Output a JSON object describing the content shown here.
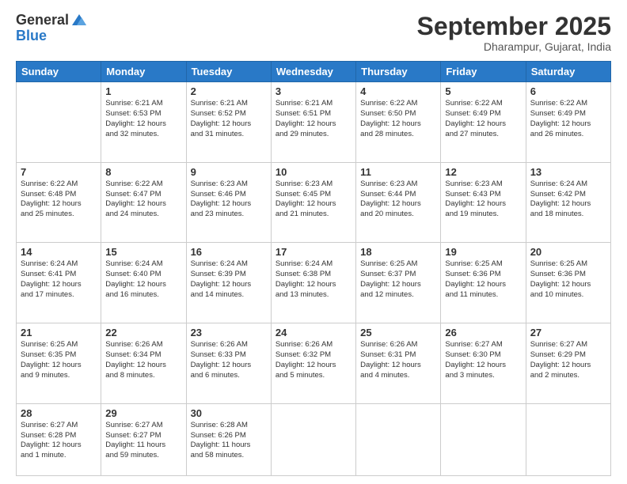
{
  "logo": {
    "general": "General",
    "blue": "Blue"
  },
  "header": {
    "month": "September 2025",
    "location": "Dharampur, Gujarat, India"
  },
  "weekdays": [
    "Sunday",
    "Monday",
    "Tuesday",
    "Wednesday",
    "Thursday",
    "Friday",
    "Saturday"
  ],
  "weeks": [
    [
      {
        "day": "",
        "info": ""
      },
      {
        "day": "1",
        "info": "Sunrise: 6:21 AM\nSunset: 6:53 PM\nDaylight: 12 hours\nand 32 minutes."
      },
      {
        "day": "2",
        "info": "Sunrise: 6:21 AM\nSunset: 6:52 PM\nDaylight: 12 hours\nand 31 minutes."
      },
      {
        "day": "3",
        "info": "Sunrise: 6:21 AM\nSunset: 6:51 PM\nDaylight: 12 hours\nand 29 minutes."
      },
      {
        "day": "4",
        "info": "Sunrise: 6:22 AM\nSunset: 6:50 PM\nDaylight: 12 hours\nand 28 minutes."
      },
      {
        "day": "5",
        "info": "Sunrise: 6:22 AM\nSunset: 6:49 PM\nDaylight: 12 hours\nand 27 minutes."
      },
      {
        "day": "6",
        "info": "Sunrise: 6:22 AM\nSunset: 6:49 PM\nDaylight: 12 hours\nand 26 minutes."
      }
    ],
    [
      {
        "day": "7",
        "info": "Sunrise: 6:22 AM\nSunset: 6:48 PM\nDaylight: 12 hours\nand 25 minutes."
      },
      {
        "day": "8",
        "info": "Sunrise: 6:22 AM\nSunset: 6:47 PM\nDaylight: 12 hours\nand 24 minutes."
      },
      {
        "day": "9",
        "info": "Sunrise: 6:23 AM\nSunset: 6:46 PM\nDaylight: 12 hours\nand 23 minutes."
      },
      {
        "day": "10",
        "info": "Sunrise: 6:23 AM\nSunset: 6:45 PM\nDaylight: 12 hours\nand 21 minutes."
      },
      {
        "day": "11",
        "info": "Sunrise: 6:23 AM\nSunset: 6:44 PM\nDaylight: 12 hours\nand 20 minutes."
      },
      {
        "day": "12",
        "info": "Sunrise: 6:23 AM\nSunset: 6:43 PM\nDaylight: 12 hours\nand 19 minutes."
      },
      {
        "day": "13",
        "info": "Sunrise: 6:24 AM\nSunset: 6:42 PM\nDaylight: 12 hours\nand 18 minutes."
      }
    ],
    [
      {
        "day": "14",
        "info": "Sunrise: 6:24 AM\nSunset: 6:41 PM\nDaylight: 12 hours\nand 17 minutes."
      },
      {
        "day": "15",
        "info": "Sunrise: 6:24 AM\nSunset: 6:40 PM\nDaylight: 12 hours\nand 16 minutes."
      },
      {
        "day": "16",
        "info": "Sunrise: 6:24 AM\nSunset: 6:39 PM\nDaylight: 12 hours\nand 14 minutes."
      },
      {
        "day": "17",
        "info": "Sunrise: 6:24 AM\nSunset: 6:38 PM\nDaylight: 12 hours\nand 13 minutes."
      },
      {
        "day": "18",
        "info": "Sunrise: 6:25 AM\nSunset: 6:37 PM\nDaylight: 12 hours\nand 12 minutes."
      },
      {
        "day": "19",
        "info": "Sunrise: 6:25 AM\nSunset: 6:36 PM\nDaylight: 12 hours\nand 11 minutes."
      },
      {
        "day": "20",
        "info": "Sunrise: 6:25 AM\nSunset: 6:36 PM\nDaylight: 12 hours\nand 10 minutes."
      }
    ],
    [
      {
        "day": "21",
        "info": "Sunrise: 6:25 AM\nSunset: 6:35 PM\nDaylight: 12 hours\nand 9 minutes."
      },
      {
        "day": "22",
        "info": "Sunrise: 6:26 AM\nSunset: 6:34 PM\nDaylight: 12 hours\nand 8 minutes."
      },
      {
        "day": "23",
        "info": "Sunrise: 6:26 AM\nSunset: 6:33 PM\nDaylight: 12 hours\nand 6 minutes."
      },
      {
        "day": "24",
        "info": "Sunrise: 6:26 AM\nSunset: 6:32 PM\nDaylight: 12 hours\nand 5 minutes."
      },
      {
        "day": "25",
        "info": "Sunrise: 6:26 AM\nSunset: 6:31 PM\nDaylight: 12 hours\nand 4 minutes."
      },
      {
        "day": "26",
        "info": "Sunrise: 6:27 AM\nSunset: 6:30 PM\nDaylight: 12 hours\nand 3 minutes."
      },
      {
        "day": "27",
        "info": "Sunrise: 6:27 AM\nSunset: 6:29 PM\nDaylight: 12 hours\nand 2 minutes."
      }
    ],
    [
      {
        "day": "28",
        "info": "Sunrise: 6:27 AM\nSunset: 6:28 PM\nDaylight: 12 hours\nand 1 minute."
      },
      {
        "day": "29",
        "info": "Sunrise: 6:27 AM\nSunset: 6:27 PM\nDaylight: 11 hours\nand 59 minutes."
      },
      {
        "day": "30",
        "info": "Sunrise: 6:28 AM\nSunset: 6:26 PM\nDaylight: 11 hours\nand 58 minutes."
      },
      {
        "day": "",
        "info": ""
      },
      {
        "day": "",
        "info": ""
      },
      {
        "day": "",
        "info": ""
      },
      {
        "day": "",
        "info": ""
      }
    ]
  ]
}
